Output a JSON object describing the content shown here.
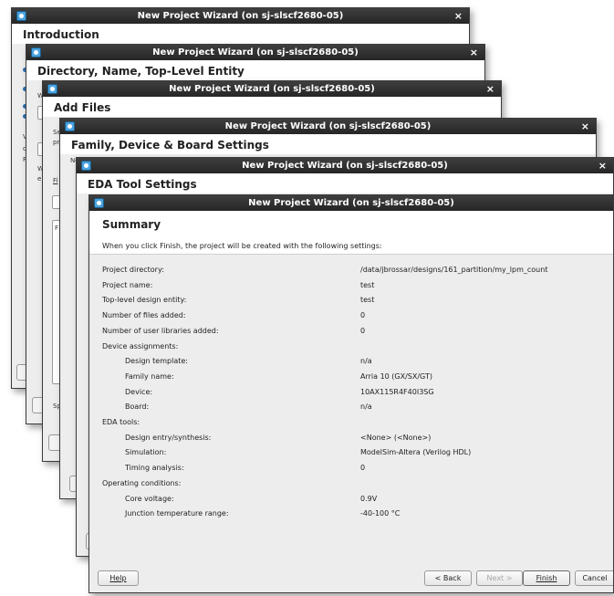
{
  "window_title": "New Project Wizard (on sj-slscf2680-05)",
  "stacked_pages": [
    {
      "heading": "Introduction"
    },
    {
      "heading": "Directory, Name, Top-Level Entity"
    },
    {
      "heading": "Add Files"
    },
    {
      "heading": "Family, Device & Board Settings"
    },
    {
      "heading": "EDA Tool Settings"
    }
  ],
  "peek_text": {
    "add_files_se": "Se",
    "add_files_pr": "pr",
    "family_ne": "Ne",
    "dir_w1": "W",
    "dir_w2": "W",
    "dir_e": "e",
    "dir_fi": "Fi",
    "dir_f": "F",
    "dir_sp": "Sp",
    "intro_v": "V",
    "intro_c": "c",
    "intro_f": "F"
  },
  "summary": {
    "title": "Summary",
    "intro": "When you click Finish, the project will be created with the following settings:",
    "rows": [
      {
        "label": "Project directory:",
        "value": "/data/jbrossar/designs/161_partition/my_lpm_count",
        "indent": false
      },
      {
        "label": "Project name:",
        "value": "test",
        "indent": false
      },
      {
        "label": "Top-level design entity:",
        "value": "test",
        "indent": false
      },
      {
        "label": "Number of files added:",
        "value": "0",
        "indent": false
      },
      {
        "label": "Number of user libraries added:",
        "value": "0",
        "indent": false
      },
      {
        "label": "Device assignments:",
        "value": "",
        "indent": false
      },
      {
        "label": "Design template:",
        "value": "n/a",
        "indent": true
      },
      {
        "label": "Family name:",
        "value": "Arria 10 (GX/SX/GT)",
        "indent": true
      },
      {
        "label": "Device:",
        "value": "10AX115R4F40I3SG",
        "indent": true
      },
      {
        "label": "Board:",
        "value": "n/a",
        "indent": true
      },
      {
        "label": "EDA tools:",
        "value": "",
        "indent": false
      },
      {
        "label": "Design entry/synthesis:",
        "value": "<None> (<None>)",
        "indent": true
      },
      {
        "label": "Simulation:",
        "value": "ModelSim-Altera (Verilog HDL)",
        "indent": true
      },
      {
        "label": "Timing analysis:",
        "value": "0",
        "indent": true
      },
      {
        "label": "Operating conditions:",
        "value": "",
        "indent": false
      },
      {
        "label": "Core voltage:",
        "value": "0.9V",
        "indent": true
      },
      {
        "label": "Junction temperature range:",
        "value": "-40-100 °C",
        "indent": true
      }
    ]
  },
  "buttons": {
    "help": "Help",
    "back": "< Back",
    "next": "Next >",
    "finish": "Finish",
    "cancel": "Cancel"
  },
  "colors": {
    "titlebar": "#2e2e2e",
    "window_bg": "#ededed",
    "header_bg": "#ffffff",
    "icon_accent": "#4aa3df"
  }
}
